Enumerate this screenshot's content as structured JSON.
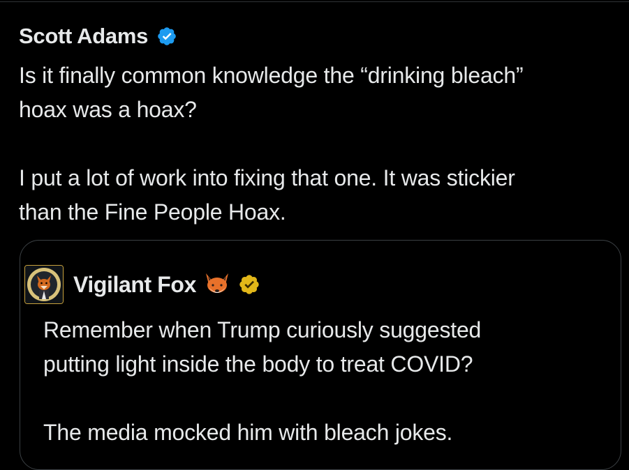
{
  "tweet": {
    "author_name": "Scott Adams",
    "verified_icon": "verified-badge-icon",
    "text": "Is it finally common knowledge the “drinking bleach”\nhoax was a hoax?\n\nI put a lot of work into fixing that one. It was stickier\nthan the Fine People Hoax."
  },
  "quote": {
    "author_name": "Vigilant Fox",
    "avatar_icon": "fox-avatar",
    "emoji_icon": "fox-emoji-icon",
    "verified_icon": "gold-verified-badge-icon",
    "text": "Remember when Trump curiously suggested\nputting light inside the body to treat COVID?\n\nThe media mocked him with bleach jokes."
  },
  "colors": {
    "background": "#000000",
    "text": "#e7e9ea",
    "verified_blue": "#1d9bf0",
    "verified_gold": "#e2b719",
    "card_border": "#3b4044"
  }
}
